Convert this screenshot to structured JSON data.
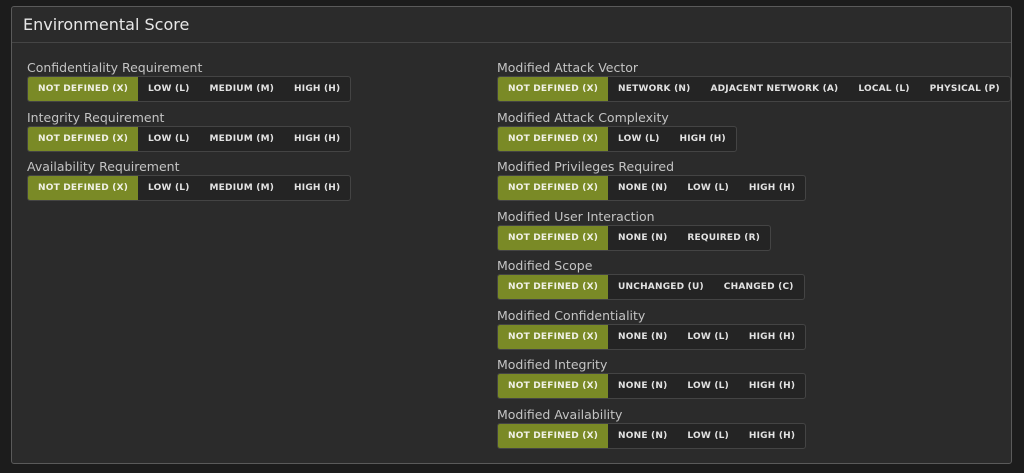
{
  "panel": {
    "title": "Environmental Score"
  },
  "colors": {
    "active": "#7a8a26",
    "panel_bg": "#2b2b2b"
  },
  "left": [
    {
      "label": "Confidentiality Requirement",
      "options": [
        "NOT DEFINED (X)",
        "LOW (L)",
        "MEDIUM (M)",
        "HIGH (H)"
      ],
      "selected": 0
    },
    {
      "label": "Integrity Requirement",
      "options": [
        "NOT DEFINED (X)",
        "LOW (L)",
        "MEDIUM (M)",
        "HIGH (H)"
      ],
      "selected": 0
    },
    {
      "label": "Availability Requirement",
      "options": [
        "NOT DEFINED (X)",
        "LOW (L)",
        "MEDIUM (M)",
        "HIGH (H)"
      ],
      "selected": 0
    }
  ],
  "right": [
    {
      "label": "Modified Attack Vector",
      "options": [
        "NOT DEFINED (X)",
        "NETWORK (N)",
        "ADJACENT NETWORK (A)",
        "LOCAL (L)",
        "PHYSICAL (P)"
      ],
      "selected": 0
    },
    {
      "label": "Modified Attack Complexity",
      "options": [
        "NOT DEFINED (X)",
        "LOW (L)",
        "HIGH (H)"
      ],
      "selected": 0
    },
    {
      "label": "Modified Privileges Required",
      "options": [
        "NOT DEFINED (X)",
        "NONE (N)",
        "LOW (L)",
        "HIGH (H)"
      ],
      "selected": 0
    },
    {
      "label": "Modified User Interaction",
      "options": [
        "NOT DEFINED (X)",
        "NONE (N)",
        "REQUIRED (R)"
      ],
      "selected": 0
    },
    {
      "label": "Modified Scope",
      "options": [
        "NOT DEFINED (X)",
        "UNCHANGED (U)",
        "CHANGED (C)"
      ],
      "selected": 0
    },
    {
      "label": "Modified Confidentiality",
      "options": [
        "NOT DEFINED (X)",
        "NONE (N)",
        "LOW (L)",
        "HIGH (H)"
      ],
      "selected": 0
    },
    {
      "label": "Modified Integrity",
      "options": [
        "NOT DEFINED (X)",
        "NONE (N)",
        "LOW (L)",
        "HIGH (H)"
      ],
      "selected": 0
    },
    {
      "label": "Modified Availability",
      "options": [
        "NOT DEFINED (X)",
        "NONE (N)",
        "LOW (L)",
        "HIGH (H)"
      ],
      "selected": 0
    }
  ]
}
